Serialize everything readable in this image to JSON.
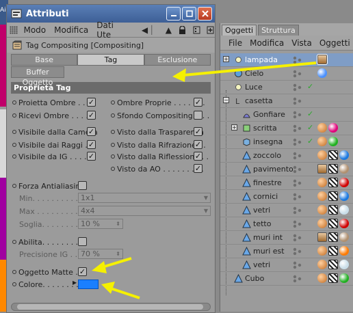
{
  "background": {
    "left_text": "Aiu"
  },
  "attributes_window": {
    "title": "Attributi",
    "menu": [
      "Modo",
      "Modifica",
      "Dati Ute"
    ],
    "tag_header": "Tag Compositing [Compositing]",
    "tabs": [
      {
        "label": "Base",
        "active": false
      },
      {
        "label": "Tag",
        "active": true
      },
      {
        "label": "Esclusione",
        "active": false
      }
    ],
    "buffer_tab": "Buffer Oggetto",
    "section_title": "Proprietà Tag",
    "left_props": [
      {
        "label": "Proietta Ombre . . . .",
        "checked": true
      },
      {
        "label": "Ricevi Ombre . . . . .",
        "checked": true
      },
      {
        "label": "Visibile dalla Camera",
        "checked": true
      },
      {
        "label": "Visibile dai Raggi . .",
        "checked": true
      },
      {
        "label": "Visibile da IG . . . .",
        "checked": true
      }
    ],
    "right_props": [
      {
        "label": "Ombre Proprie . . . . . . .",
        "checked": true
      },
      {
        "label": "Sfondo Compositing. . . .",
        "checked": false
      },
      {
        "label": "Visto dalla Trasparenza",
        "checked": true
      },
      {
        "label": "Visto dalla Rifrazione . .",
        "checked": true
      },
      {
        "label": "Visto dalla Riflessione . .",
        "checked": true
      },
      {
        "label": "Visto da AO . . . . . . . . .",
        "checked": true
      }
    ],
    "antialias": {
      "label": "Forza Antialiasing",
      "checked": false,
      "min_label": "Min. . . . . . . . . .",
      "min_value": "1x1",
      "max_label": "Max . . . . . . . . .",
      "max_value": "4x4",
      "soglia_label": "Soglia. . . . . . . .",
      "soglia_value": "10 %"
    },
    "gi": {
      "label": "Abilita. . . . . . . . .",
      "checked": false,
      "precision_label": "Precisione IG . . . .",
      "precision_value": "70 %"
    },
    "matte": {
      "label": "Oggetto Matte . .",
      "checked": true
    },
    "color": {
      "label": "Colore. . . . . . . .",
      "value": "#1a7fff"
    }
  },
  "objects_panel": {
    "tabs": [
      {
        "label": "Oggetti",
        "active": true
      },
      {
        "label": "Struttura",
        "active": false
      }
    ],
    "menu": [
      "File",
      "Modifica",
      "Vista",
      "Oggetti"
    ],
    "objects": [
      {
        "name": "lampada",
        "icon": "light-icon",
        "selected": true,
        "tags": [
          "compositing-tag-icon"
        ]
      },
      {
        "name": "Cielo",
        "icon": "sky-icon",
        "selected": false,
        "tags": [
          "sky-material-icon"
        ]
      },
      {
        "name": "Luce",
        "icon": "light-icon",
        "selected": false,
        "tags": []
      },
      {
        "name": "casetta",
        "icon": "null-object-icon",
        "selected": false,
        "tags": []
      },
      {
        "name": "Gonfiare",
        "icon": "deformer-icon",
        "selected": false,
        "tags": []
      },
      {
        "name": "scritta",
        "icon": "extrude-icon",
        "selected": false,
        "tags": [
          "phong-tag-icon",
          "magenta-material-icon"
        ]
      },
      {
        "name": "insegna",
        "icon": "cube-icon",
        "selected": false,
        "tags": [
          "phong-tag-icon",
          "green-material-icon"
        ]
      },
      {
        "name": "zoccolo",
        "icon": "polygon-object-icon",
        "selected": false,
        "tags": [
          "phong-tag-icon",
          "uvw-tag-icon",
          "blue-material-icon"
        ]
      },
      {
        "name": "pavimento",
        "icon": "polygon-object-icon",
        "selected": false,
        "tags": [
          "compositing-tag-icon",
          "uvw-tag-icon",
          "texture-material-icon"
        ]
      },
      {
        "name": "finestre",
        "icon": "polygon-object-icon",
        "selected": false,
        "tags": [
          "phong-tag-icon",
          "uvw-tag-icon",
          "red-material-icon"
        ]
      },
      {
        "name": "cornici",
        "icon": "polygon-object-icon",
        "selected": false,
        "tags": [
          "phong-tag-icon",
          "uvw-tag-icon",
          "blue-material-icon"
        ]
      },
      {
        "name": "vetri",
        "icon": "polygon-object-icon",
        "selected": false,
        "tags": [
          "phong-tag-icon",
          "uvw-tag-icon",
          "glass-material-icon"
        ]
      },
      {
        "name": "tetto",
        "icon": "polygon-object-icon",
        "selected": false,
        "tags": [
          "phong-tag-icon",
          "uvw-tag-icon",
          "red-material-icon"
        ]
      },
      {
        "name": "muri int",
        "icon": "polygon-object-icon",
        "selected": false,
        "tags": [
          "compositing-tag-icon",
          "uvw-tag-icon",
          "texture-material-icon"
        ]
      },
      {
        "name": "muri est",
        "icon": "polygon-object-icon",
        "selected": false,
        "tags": [
          "phong-tag-icon",
          "uvw-tag-icon",
          "orange-material-icon"
        ]
      },
      {
        "name": "vetri",
        "icon": "polygon-object-icon",
        "selected": false,
        "tags": [
          "phong-tag-icon",
          "uvw-tag-icon",
          "glass-material-icon"
        ]
      },
      {
        "name": "Cubo",
        "icon": "polygon-object-icon",
        "selected": false,
        "tags": [
          "phong-tag-icon",
          "uvw-tag-icon",
          "green-material-icon"
        ]
      }
    ]
  },
  "colors": {
    "title_bar": "#4a6fa8",
    "annotation_arrow": "#f5f000",
    "selected_row": "#7f9dc6",
    "swatch": "#1a7fff"
  }
}
